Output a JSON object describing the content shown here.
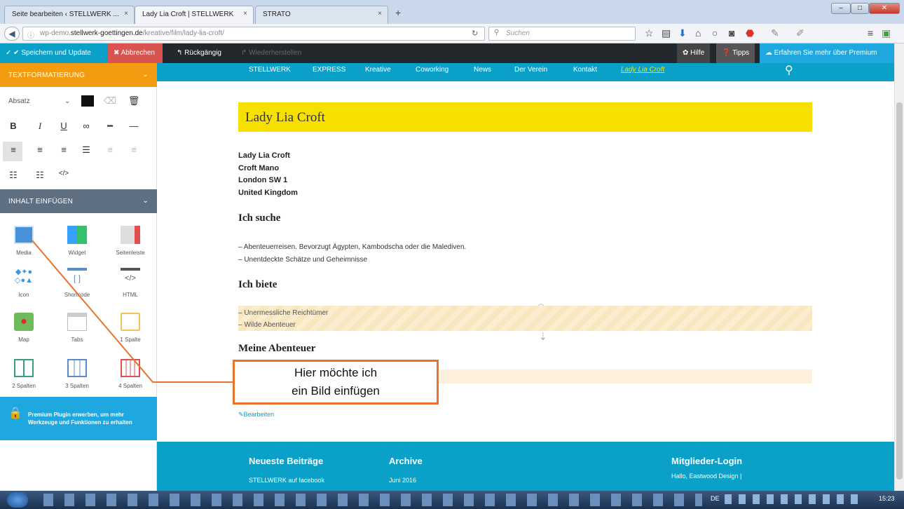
{
  "browser": {
    "tabs": [
      "Seite bearbeiten ‹ STELLWERK ...",
      "Lady Lia Croft | STELLWERK",
      "STRATO"
    ],
    "url_prefix": "wp-demo.",
    "url_domain": "stellwerk-goettingen.de",
    "url_path": "/kreative/film/lady-lia-croft/",
    "search_placeholder": "Suchen",
    "new_tab": "+",
    "close": "×"
  },
  "editor_toolbar": {
    "save": "Speichern und Update",
    "cancel": "Abbrechen",
    "undo": "Rückgängig",
    "redo": "Wiederherstellen",
    "help": "Hilfe",
    "tips": "Tipps",
    "premium": "Erfahren Sie mehr über Premium"
  },
  "sidebar": {
    "text_format_header": "TEXTFORMATIERUNG",
    "paragraph_select": "Absatz",
    "insert_header": "INHALT EINFÜGEN",
    "widgets": [
      "Media",
      "Widget",
      "Seitenleiste",
      "Icon",
      "Shortcode",
      "HTML",
      "Map",
      "Tabs",
      "1 Spalte",
      "2 Spalten",
      "3 Spalten",
      "4 Spalten"
    ],
    "premium_line1": "Premium Plugin erwerben, um mehr",
    "premium_line2": "Werkzeuge und Funktionen zu erhalten"
  },
  "site_nav": {
    "items": [
      "STELLWERK",
      "EXPRESS",
      "Kreative",
      "Coworking",
      "News",
      "Der Verein",
      "Kontakt",
      "Lady Lia Croft"
    ]
  },
  "content": {
    "title": "Lady Lia Croft",
    "address": [
      "Lady Lia Croft",
      "Croft Mano",
      "London SW 1",
      "United Kingdom"
    ],
    "h_search": "Ich suche",
    "search_items": [
      "– Abenteuerreisen. Bevorzugt Ägypten, Kambodscha oder die Malediven.",
      "– Unentdeckte Schätze und Geheimnisse"
    ],
    "h_offer": "Ich biete",
    "offer_items": [
      "– Unermessliche Reichtümer",
      "– Wilde Abenteuer"
    ],
    "h_adventures": "Meine Abenteuer",
    "edit_link": "Bearbeiten"
  },
  "annotation": {
    "line1": "Hier möchte ich",
    "line2": "ein Bild einfügen",
    "color": "#e8732a"
  },
  "footer": {
    "recent_title": "Neueste Beiträge",
    "recent_item": "STELLWERK auf facebook",
    "archive_title": "Archive",
    "archive_item": "Juni 2016",
    "login_title": "Mitglieder-Login",
    "login_text": "Hallo, Eastwood Design |"
  },
  "taskbar": {
    "lang": "DE",
    "time": "15:23"
  },
  "colors": {
    "accent_teal": "#0aa0c8",
    "sidebar_orange": "#f39c12",
    "title_yellow": "#f7e000",
    "premium_blue": "#1fa8e0"
  }
}
